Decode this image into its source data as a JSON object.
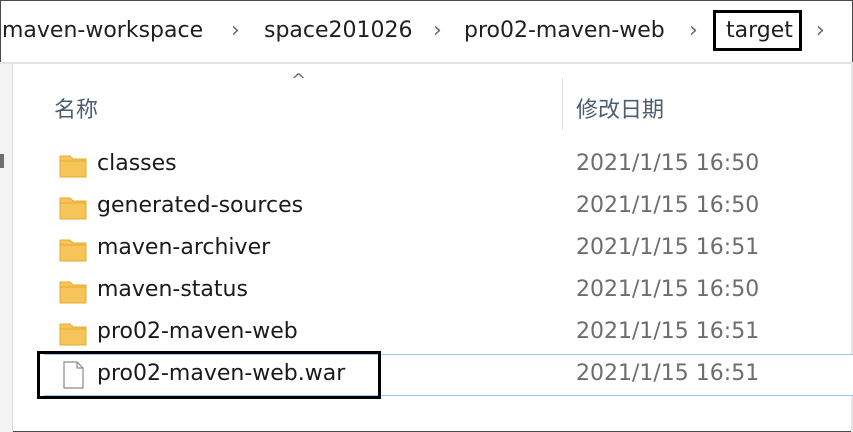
{
  "breadcrumb": {
    "items": [
      "maven-workspace",
      "space201026",
      "pro02-maven-web",
      "target"
    ],
    "separator": "›",
    "trailing": "›"
  },
  "columns": {
    "name": "名称",
    "date_modified": "修改日期",
    "sort_caret": "^"
  },
  "files": [
    {
      "name": "classes",
      "date": "2021/1/15 16:50",
      "type": "folder"
    },
    {
      "name": "generated-sources",
      "date": "2021/1/15 16:50",
      "type": "folder"
    },
    {
      "name": "maven-archiver",
      "date": "2021/1/15 16:51",
      "type": "folder"
    },
    {
      "name": "maven-status",
      "date": "2021/1/15 16:50",
      "type": "folder"
    },
    {
      "name": "pro02-maven-web",
      "date": "2021/1/15 16:51",
      "type": "folder"
    },
    {
      "name": "pro02-maven-web.war",
      "date": "2021/1/15 16:51",
      "type": "file"
    }
  ],
  "colors": {
    "folder": "#f5c55a",
    "folder_tab": "#e7a92f",
    "header_text": "#4d5d70",
    "date_text": "#6d6d6d",
    "selection_border": "#99c9ef",
    "highlight_box": "#000000"
  },
  "icons": {
    "folder": "folder-icon",
    "file": "file-icon"
  }
}
